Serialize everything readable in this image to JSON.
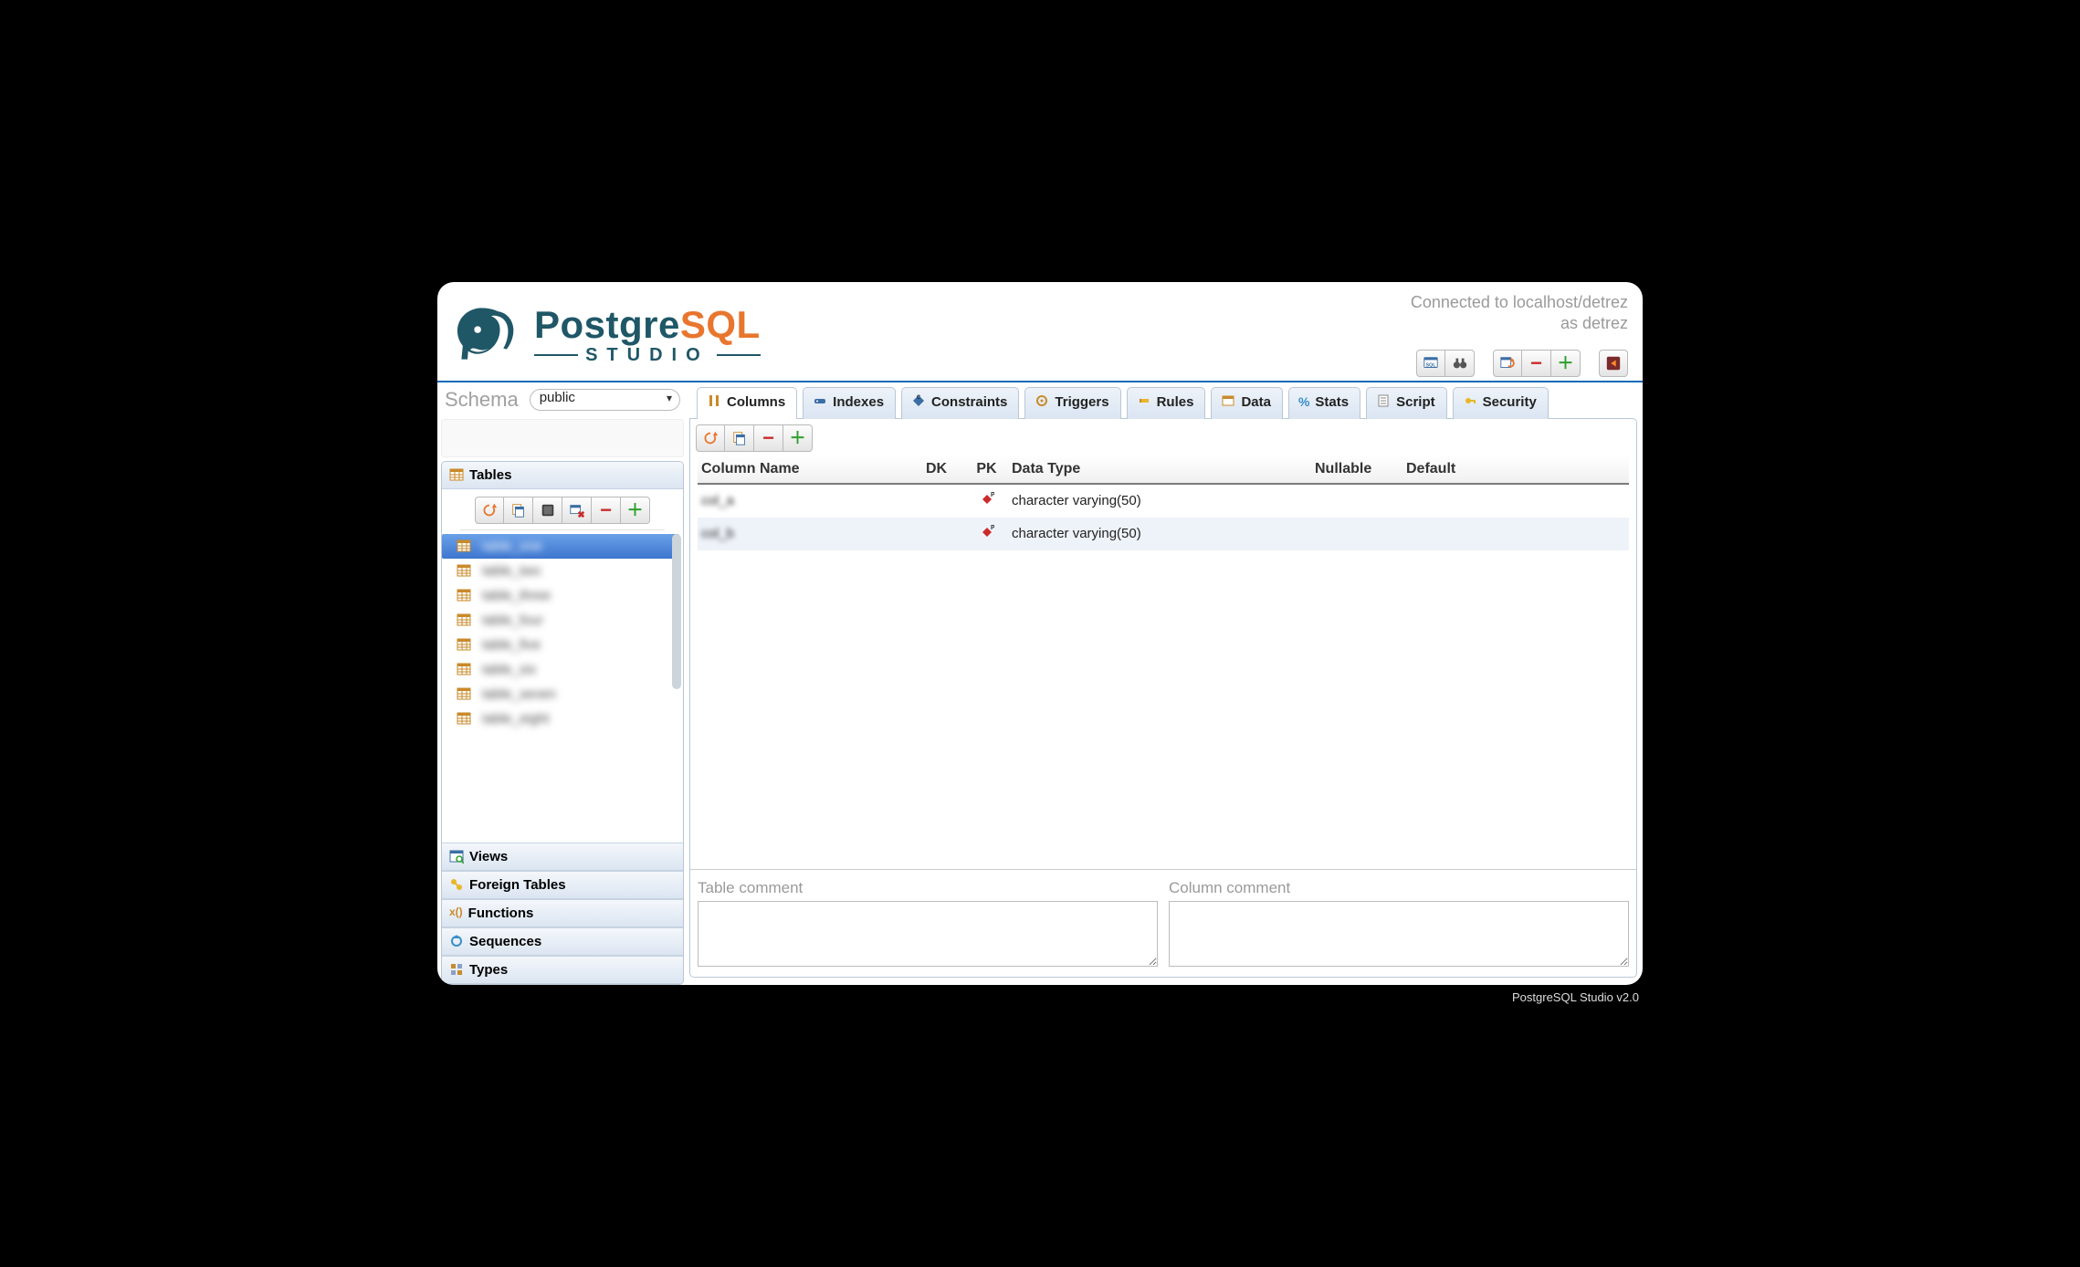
{
  "header": {
    "logo": {
      "postgre": "Postgre",
      "sql": "SQL",
      "studio": "STUDIO"
    },
    "connected_line1": "Connected to localhost/detrez",
    "connected_line2": "as detrez",
    "toolbar_groups": [
      {
        "buttons": [
          {
            "name": "sql-editor-icon"
          },
          {
            "name": "binoculars-icon"
          }
        ]
      },
      {
        "buttons": [
          {
            "name": "refresh-schema-icon"
          },
          {
            "name": "remove-schema-icon"
          },
          {
            "name": "add-schema-icon"
          }
        ]
      },
      {
        "buttons": [
          {
            "name": "logout-icon"
          }
        ]
      }
    ]
  },
  "sidebar": {
    "schema_label": "Schema",
    "schema_value": "public",
    "sections": {
      "tables": {
        "label": "Tables"
      },
      "views": {
        "label": "Views"
      },
      "foreign_tables": {
        "label": "Foreign Tables"
      },
      "functions": {
        "label": "Functions"
      },
      "sequences": {
        "label": "Sequences"
      },
      "types": {
        "label": "Types"
      }
    },
    "tables_toolbar": [
      "refresh-icon",
      "copy-table-icon",
      "properties-icon",
      "truncate-icon",
      "remove-icon",
      "add-icon"
    ],
    "tables": [
      {
        "label": "table_one",
        "selected": true
      },
      {
        "label": "table_two",
        "selected": false
      },
      {
        "label": "table_three",
        "selected": false
      },
      {
        "label": "table_four",
        "selected": false
      },
      {
        "label": "table_five",
        "selected": false
      },
      {
        "label": "table_six",
        "selected": false
      },
      {
        "label": "table_seven",
        "selected": false
      },
      {
        "label": "table_eight",
        "selected": false
      }
    ]
  },
  "tabs": [
    {
      "key": "columns",
      "label": "Columns",
      "icon": "columns-icon",
      "active": true
    },
    {
      "key": "indexes",
      "label": "Indexes",
      "icon": "indexes-icon",
      "active": false
    },
    {
      "key": "constraints",
      "label": "Constraints",
      "icon": "constraints-icon",
      "active": false
    },
    {
      "key": "triggers",
      "label": "Triggers",
      "icon": "triggers-icon",
      "active": false
    },
    {
      "key": "rules",
      "label": "Rules",
      "icon": "rules-icon",
      "active": false
    },
    {
      "key": "data",
      "label": "Data",
      "icon": "data-icon",
      "active": false
    },
    {
      "key": "stats",
      "label": "Stats",
      "icon": "stats-icon",
      "active": false
    },
    {
      "key": "script",
      "label": "Script",
      "icon": "script-icon",
      "active": false
    },
    {
      "key": "security",
      "label": "Security",
      "icon": "security-icon",
      "active": false
    }
  ],
  "columns_toolbar": [
    "refresh-icon",
    "rename-icon",
    "remove-icon",
    "add-icon"
  ],
  "grid": {
    "headers": {
      "name": "Column Name",
      "dk": "DK",
      "pk": "PK",
      "type": "Data Type",
      "nullable": "Nullable",
      "default": "Default"
    },
    "rows": [
      {
        "name": "col_a",
        "dk": "",
        "pk": true,
        "type": "character varying(50)",
        "nullable": "",
        "default": ""
      },
      {
        "name": "col_b",
        "dk": "",
        "pk": true,
        "type": "character varying(50)",
        "nullable": "",
        "default": ""
      }
    ]
  },
  "comments": {
    "table_label": "Table comment",
    "column_label": "Column comment",
    "table_value": "",
    "column_value": ""
  },
  "footer": "PostgreSQL Studio v2.0"
}
